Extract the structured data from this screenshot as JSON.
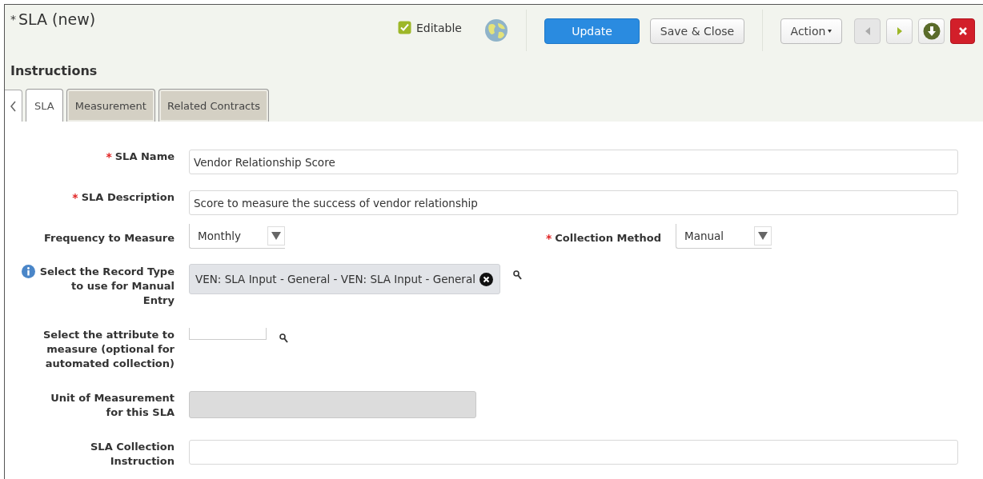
{
  "window": {
    "title": "SLA (new)",
    "modified_mark": "*"
  },
  "header": {
    "editable": {
      "label": "Editable",
      "checked": true
    },
    "buttons": [
      {
        "label": "Update",
        "kind": "primary"
      },
      {
        "label": "Save & Close",
        "kind": "default"
      },
      {
        "label": "Action",
        "kind": "menu"
      }
    ],
    "nav": [
      {
        "kind": "prev",
        "disabled": true
      },
      {
        "kind": "next",
        "disabled": false
      },
      {
        "kind": "download"
      },
      {
        "kind": "close"
      }
    ]
  },
  "section": {
    "title": "Instructions"
  },
  "tabs": [
    {
      "label": "SLA",
      "selected": true
    },
    {
      "label": "Measurement",
      "selected": false
    },
    {
      "label": "Related Contracts",
      "selected": false
    }
  ],
  "rows": [
    {
      "fields": [
        {
          "label": "SLA Name",
          "required": true,
          "kind": "text",
          "value": "Vendor Relationship Score"
        }
      ]
    },
    {
      "fields": [
        {
          "label": "SLA Description",
          "required": true,
          "kind": "text",
          "value": "Score to measure the success of vendor relationship"
        }
      ]
    },
    {
      "fields": [
        {
          "label": "Frequency to Measure",
          "required": false,
          "kind": "select",
          "value": "Monthly"
        },
        {
          "label": "Collection Method",
          "required": true,
          "kind": "select",
          "value": "Manual"
        }
      ]
    },
    {
      "fields": [
        {
          "label": "Select the Record Type to use for Manual Entry",
          "required": false,
          "info": true,
          "kind": "lookup",
          "value": "VEN: SLA Input - General - VEN: SLA Input - General"
        }
      ]
    },
    {
      "fields": [
        {
          "label": "Select the attribute to measure (optional for automated collection)",
          "required": false,
          "kind": "lookup"
        }
      ]
    },
    {
      "fields": [
        {
          "label": "Unit of Measurement for this SLA",
          "required": false,
          "kind": "disabled"
        }
      ]
    },
    {
      "fields": [
        {
          "label": "SLA Collection Instruction",
          "required": false,
          "kind": "text"
        }
      ]
    }
  ]
}
